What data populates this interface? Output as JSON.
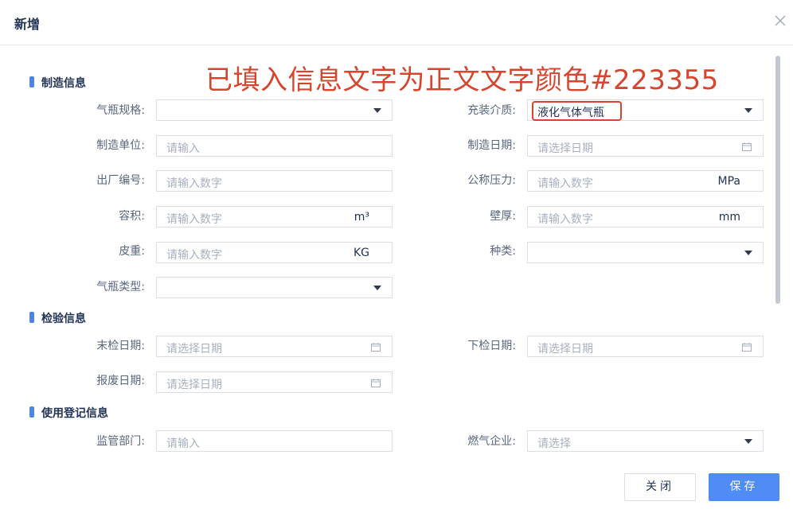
{
  "dialog": {
    "title": "新增",
    "close_icon": "close-icon"
  },
  "annotation": {
    "text": "已填入信息文字为正文文字颜色#223355",
    "color": "#d6452d"
  },
  "colors": {
    "text": "#223355",
    "label": "#596680",
    "placeholder": "#a8b0c0",
    "accent": "#4a86e8",
    "primary_button": "#4f8cf6",
    "border": "#dcdfe6"
  },
  "sections": {
    "manufacture": "制造信息",
    "inspection": "检验信息",
    "registration": "使用登记信息"
  },
  "fields": {
    "cylinder_spec": {
      "label": "气瓶规格:",
      "value": ""
    },
    "fill_medium": {
      "label": "充装介质:",
      "value": "液化气体气瓶"
    },
    "manufacturer": {
      "label": "制造单位:",
      "placeholder": "请输入"
    },
    "manufacture_date": {
      "label": "制造日期:",
      "placeholder": "请选择日期"
    },
    "factory_number": {
      "label": "出厂编号:",
      "placeholder": "请输入数字"
    },
    "nominal_pressure": {
      "label": "公称压力:",
      "placeholder": "请输入数字",
      "unit": "MPa"
    },
    "volume": {
      "label": "容积:",
      "placeholder": "请输入数字",
      "unit": "m³"
    },
    "wall_thickness": {
      "label": "壁厚:",
      "placeholder": "请输入数字",
      "unit": "mm"
    },
    "tare_weight": {
      "label": "皮重:",
      "placeholder": "请输入数字",
      "unit": "KG"
    },
    "category": {
      "label": "种类:",
      "value": ""
    },
    "cylinder_type": {
      "label": "气瓶类型:",
      "value": ""
    },
    "last_inspection_date": {
      "label": "末检日期:",
      "placeholder": "请选择日期"
    },
    "next_inspection_date": {
      "label": "下检日期:",
      "placeholder": "请选择日期"
    },
    "scrap_date": {
      "label": "报废日期:",
      "placeholder": "请选择日期"
    },
    "supervision_dept": {
      "label": "监管部门:",
      "placeholder": "请输入"
    },
    "gas_company": {
      "label": "燃气企业:",
      "placeholder": "请选择"
    }
  },
  "buttons": {
    "close": "关闭",
    "save": "保存"
  }
}
